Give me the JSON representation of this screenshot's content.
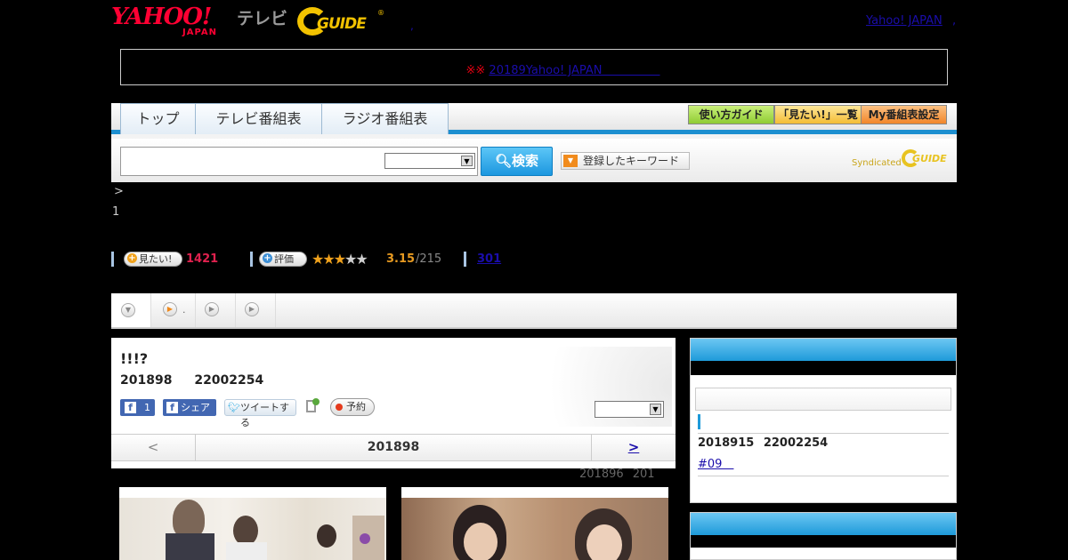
{
  "header": {
    "logo_yahoo": "YAHOO!",
    "logo_japan": "JAPAN",
    "logo_tv": "テレビ",
    "logo_gguide": "GUIDE",
    "dot": ",",
    "yahoo_japan_link": "Yahoo! JAPAN",
    "yahoo_japan_dot": ","
  },
  "notice": {
    "marks": "※※",
    "link": "20189Yahoo! JAPAN　　　　　"
  },
  "nav": {
    "tabs": [
      "トップ",
      "テレビ番組表",
      "ラジオ番組表"
    ],
    "tools": [
      "使い方ガイド",
      "「見たい!」一覧",
      "My番組表設定"
    ],
    "tool_colors": [
      "#9ad640",
      "#f9c83e",
      "#f48d2b"
    ],
    "search_button": "検索",
    "keyword_button": "登録したキーワード",
    "syndicated": "Syndicated",
    "syndicated_logo": "GUIDE"
  },
  "breadcrumb": {
    "arrow": ">",
    "line2": "1"
  },
  "stats": {
    "want_label": "見たい!",
    "want_count": "1421",
    "rate_label": "評価",
    "stars_on": 3,
    "stars_total": 5,
    "rating": "3.15",
    "rating_count": "/215",
    "review_link": "301"
  },
  "playbar": {
    "item2_label": "."
  },
  "program": {
    "title": "!!!?",
    "date": "201898 22002254",
    "fb_like_count": "1",
    "fb_share": "シェア",
    "tweet": "ツイートする",
    "reserve": "予約",
    "day_prev": "<",
    "day_label": "201898",
    "day_next": ">",
    "update_note": "201896 201"
  },
  "sidebar": {
    "datetime": "2018915 22002254",
    "episode_link": "#09　"
  }
}
